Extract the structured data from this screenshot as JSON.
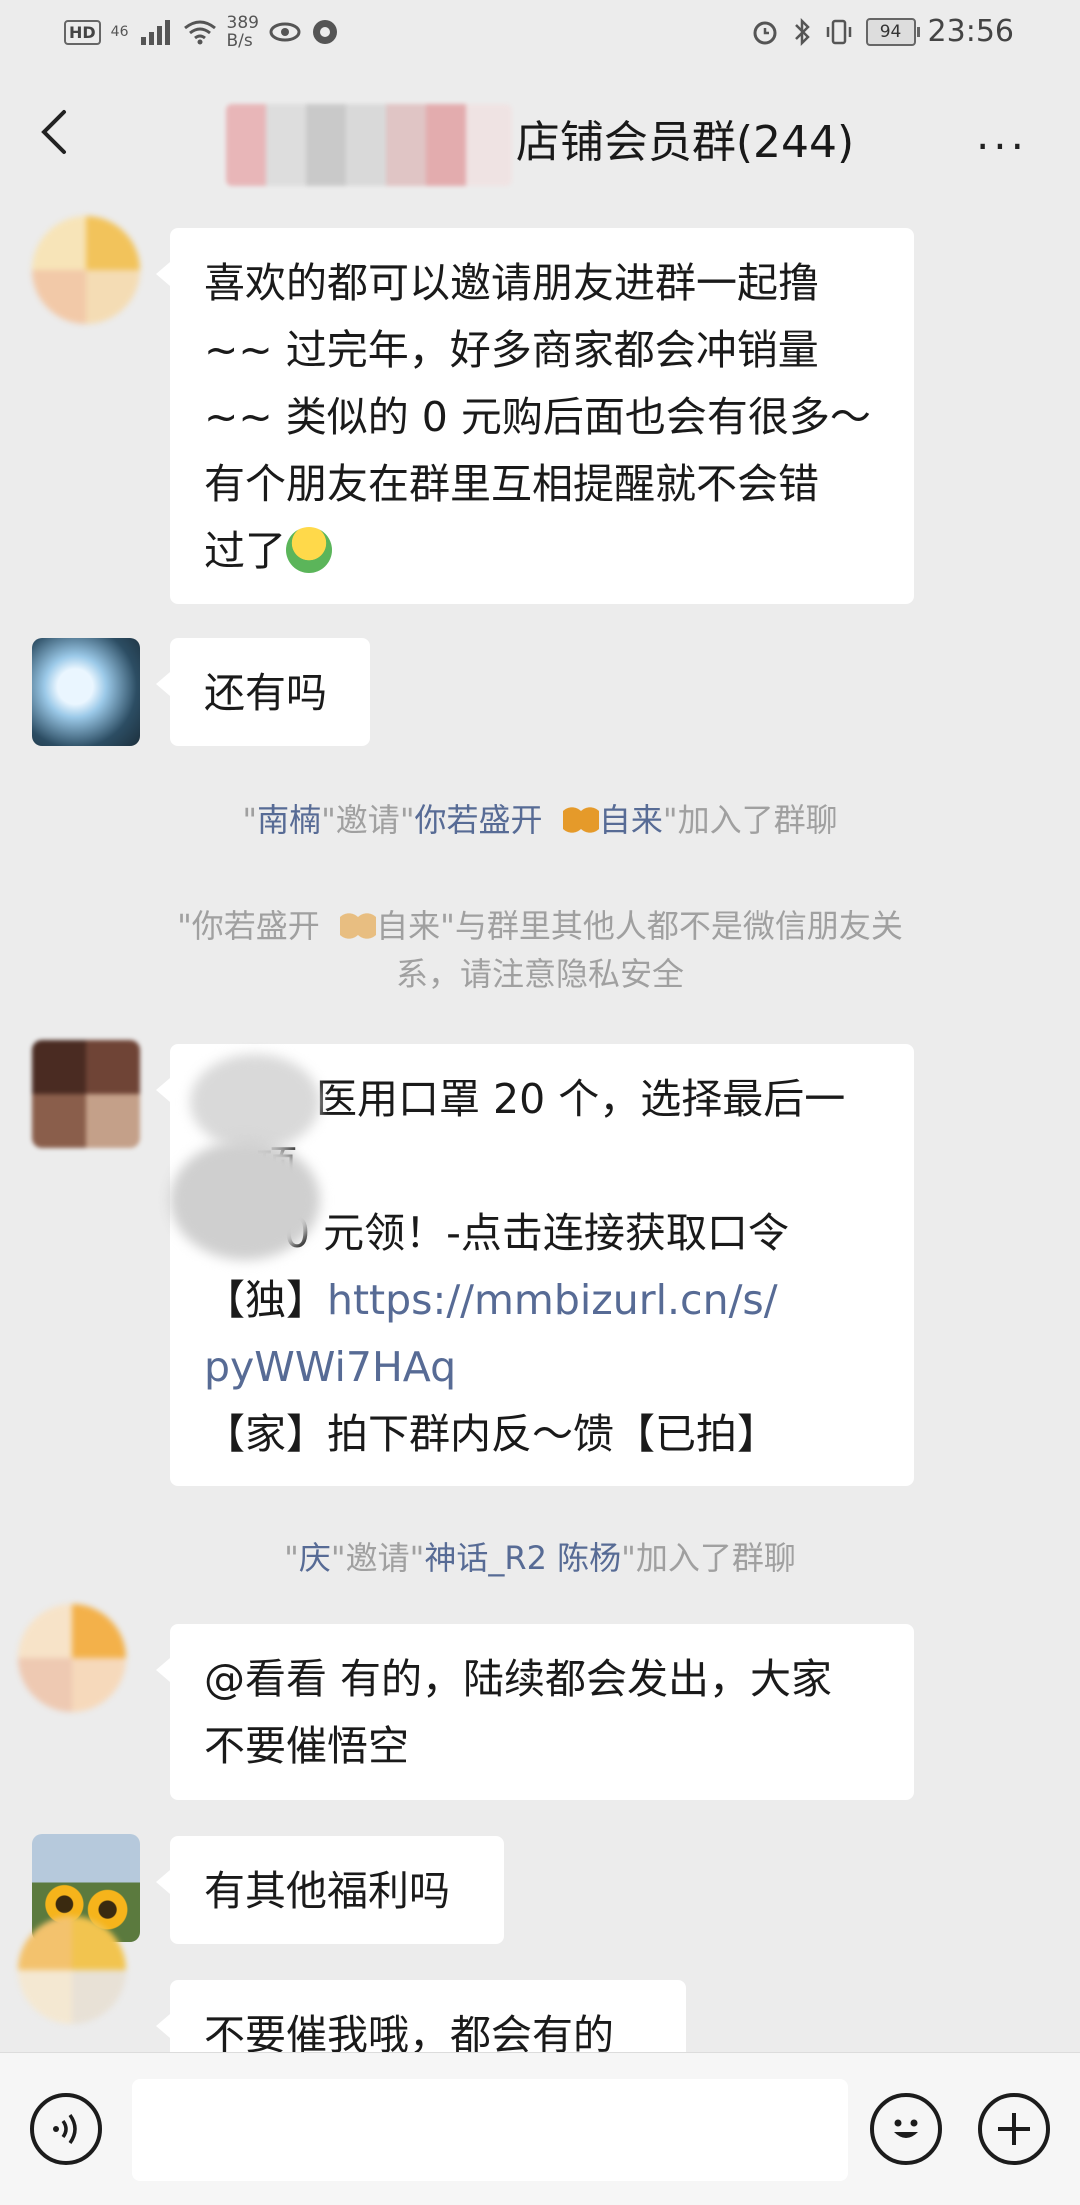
{
  "status_bar": {
    "hd": "HD",
    "network": "46",
    "speed_value": "389",
    "speed_unit": "B/s",
    "battery": "94",
    "time": "23:56"
  },
  "header": {
    "title": "店铺会员群(244)",
    "back_icon": "chevron-left-icon",
    "more_icon": "more-icon",
    "more_label": "···"
  },
  "messages": [
    {
      "type": "text",
      "lines": [
        "喜欢的都可以邀请朋友进群一起撸",
        "~~ 过完年，好多商家都会冲销量",
        "~~ 类似的 0 元购后面也会有很多～",
        "有个朋友在群里互相提醒就不会错",
        "过了"
      ]
    },
    {
      "type": "text",
      "text": "还有吗"
    },
    {
      "type": "system",
      "inviter": "南楠",
      "invited": "你若盛开",
      "invited2": "自来",
      "suffix": "加入了群聊"
    },
    {
      "type": "notice",
      "name1": "你若盛开",
      "name2": "自来",
      "line1_tail": "\"与群里其他人都不是微信朋友关",
      "line2": "系，请注意隐私安全"
    },
    {
      "type": "text",
      "lines": [
        "医用口罩 20 个，选择最后一",
        "项",
        "0 元领！-点击连接获取口令",
        "【独】",
        "https://mmbizurl.cn/s/",
        "pyWWi7HAq",
        "【家】拍下群内反～馈【已拍】"
      ]
    },
    {
      "type": "system",
      "inviter": "庆",
      "invited": "神话_R2 陈杨",
      "suffix": "加入了群聊"
    },
    {
      "type": "text",
      "lines": [
        "@看看  有的，陆续都会发出，大家",
        "不要催悟空"
      ]
    },
    {
      "type": "text",
      "text": "有其他福利吗"
    },
    {
      "type": "text",
      "text": "不要催我哦，都会有的"
    }
  ],
  "system_words": {
    "quote": "\"",
    "invite": "邀请"
  },
  "input_bar": {
    "voice_icon": "voice-icon",
    "emoji_icon": "emoji-icon",
    "plus_icon": "plus-icon",
    "placeholder": ""
  }
}
